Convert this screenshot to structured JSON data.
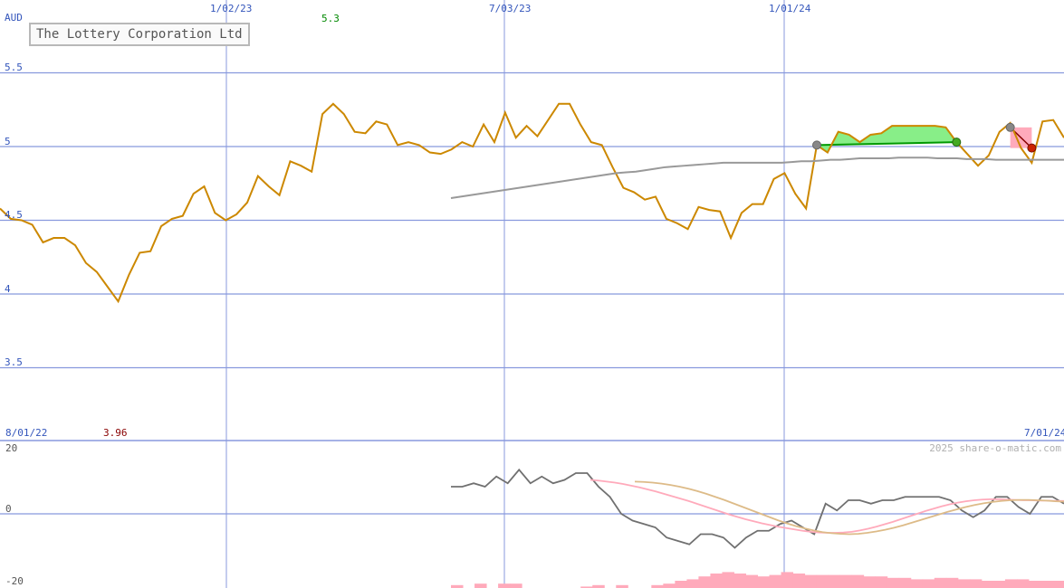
{
  "chart_data": {
    "type": "line",
    "title": "The Lottery Corporation Ltd",
    "currency": "AUD",
    "watermark": "2025 share-o-matic.com",
    "date_range": {
      "start": "8/01/22",
      "end": "7/01/24"
    },
    "high_label": "5.3",
    "low_label": "3.96",
    "x_ticks": [
      "1/02/23",
      "7/03/23",
      "1/01/24"
    ],
    "price_axis": {
      "ticks": [
        "5.5",
        "5",
        "4.5",
        "4",
        "3.5"
      ],
      "ylim": [
        3.5,
        5.5
      ]
    },
    "osc_axis": {
      "ticks": [
        "20",
        "0",
        "-20"
      ],
      "ylim": [
        -20,
        20
      ]
    },
    "colors": {
      "price": "#cc8800",
      "ma_long": "#999999",
      "grid": "#8899dd",
      "axis_text": "#3355bb",
      "high": "#008800",
      "low": "#880000",
      "osc": "#707070",
      "osc_signal1": "#ffaabb",
      "osc_signal2": "#ddbb88",
      "volume": "#ffaabb",
      "gain_fill": "#88ee88",
      "loss_fill": "#ffaabb"
    },
    "series": [
      {
        "name": "price",
        "values": [
          4.58,
          4.51,
          4.5,
          4.47,
          4.35,
          4.38,
          4.38,
          4.33,
          4.21,
          4.15,
          4.05,
          3.95,
          4.13,
          4.28,
          4.29,
          4.46,
          4.51,
          4.53,
          4.68,
          4.73,
          4.55,
          4.5,
          4.54,
          4.62,
          4.8,
          4.73,
          4.67,
          4.9,
          4.87,
          4.83,
          5.22,
          5.29,
          5.22,
          5.1,
          5.09,
          5.17,
          5.15,
          5.01,
          5.03,
          5.01,
          4.96,
          4.95,
          4.98,
          5.03,
          5.0,
          5.15,
          5.03,
          5.23,
          5.06,
          5.14,
          5.07,
          5.18,
          5.29,
          5.29,
          5.15,
          5.03,
          5.01,
          4.86,
          4.72,
          4.69,
          4.64,
          4.66,
          4.51,
          4.48,
          4.44,
          4.59,
          4.57,
          4.56,
          4.38,
          4.55,
          4.61,
          4.61,
          4.78,
          4.82,
          4.68,
          4.58,
          5.01,
          4.96,
          5.1,
          5.08,
          5.03,
          5.08,
          5.09,
          5.14,
          5.14,
          5.14,
          5.14,
          5.14,
          5.13,
          5.03,
          4.95,
          4.87,
          4.94,
          5.1,
          5.16,
          4.99,
          4.89,
          5.17,
          5.18,
          5.06
        ]
      },
      {
        "name": "ma_long",
        "values": [
          4.65,
          4.66,
          4.67,
          4.68,
          4.69,
          4.7,
          4.71,
          4.72,
          4.73,
          4.74,
          4.75,
          4.76,
          4.77,
          4.78,
          4.79,
          4.8,
          4.81,
          4.82,
          4.825,
          4.83,
          4.84,
          4.85,
          4.86,
          4.865,
          4.87,
          4.875,
          4.88,
          4.885,
          4.89,
          4.89,
          4.89,
          4.89,
          4.89,
          4.89,
          4.89,
          4.895,
          4.9,
          4.9,
          4.905,
          4.91,
          4.91,
          4.915,
          4.92,
          4.92,
          4.92,
          4.92,
          4.925,
          4.925,
          4.925,
          4.925,
          4.92,
          4.92,
          4.92,
          4.915,
          4.915,
          4.915,
          4.91,
          4.91,
          4.91,
          4.91,
          4.91,
          4.91,
          4.91,
          4.91
        ]
      },
      {
        "name": "oscillator",
        "values": [
          8,
          8,
          9,
          8,
          11,
          9,
          13,
          9,
          11,
          9,
          10,
          12,
          12,
          8,
          5,
          0,
          -2,
          -3,
          -4,
          -7,
          -8,
          -9,
          -6,
          -6,
          -7,
          -10,
          -7,
          -5,
          -5,
          -3,
          -2,
          -4,
          -6,
          3,
          1,
          4,
          4,
          3,
          4,
          4,
          5,
          5,
          5,
          5,
          4,
          1,
          -1,
          1,
          5,
          5,
          2,
          0,
          5,
          5,
          3
        ]
      },
      {
        "name": "signal_1",
        "values": [
          10,
          9.8,
          9.5,
          9.2,
          8.8,
          8.3,
          7.8,
          7.2,
          6.6,
          5.9,
          5.2,
          4.5,
          3.8,
          3.0,
          2.2,
          1.4,
          0.6,
          -0.2,
          -0.9,
          -1.6,
          -2.2,
          -2.8,
          -3.3,
          -3.8,
          -4.2,
          -4.6,
          -5.0,
          -5.3,
          -5.5,
          -5.6,
          -5.6,
          -5.5,
          -5.3,
          -4.9,
          -4.4,
          -3.8,
          -3.1,
          -2.4,
          -1.6,
          -0.8,
          0,
          0.8,
          1.5,
          2.2,
          2.8,
          3.3,
          3.7,
          4.0,
          4.2,
          4.3,
          4.3,
          4.2,
          4.1,
          4.0,
          4.0,
          3.9,
          3.9,
          3.8,
          3.8
        ]
      },
      {
        "name": "signal_2",
        "values": [
          9.5,
          9.4,
          9.2,
          8.9,
          8.5,
          8.0,
          7.4,
          6.7,
          5.9,
          5.0,
          4.1,
          3.1,
          2.1,
          1.1,
          0.1,
          -0.9,
          -1.9,
          -2.8,
          -3.6,
          -4.3,
          -4.9,
          -5.4,
          -5.7,
          -5.9,
          -6.0,
          -5.9,
          -5.6,
          -5.2,
          -4.7,
          -4.1,
          -3.4,
          -2.6,
          -1.8,
          -1.0,
          -0.2,
          0.6,
          1.3,
          2.0,
          2.6,
          3.1,
          3.5,
          3.8,
          4.0,
          4.1,
          4.1,
          4.0,
          3.9,
          3.7,
          3.6
        ]
      },
      {
        "name": "volume",
        "values": [
          0.2,
          0,
          0.3,
          0,
          0.3,
          0.3,
          0,
          0,
          0,
          0,
          0,
          0.1,
          0.2,
          0,
          0.2,
          0,
          0,
          0.2,
          0.3,
          0.5,
          0.6,
          0.8,
          1.0,
          1.1,
          1.0,
          0.9,
          0.8,
          0.9,
          1.1,
          1.0,
          0.9,
          0.9,
          0.9,
          0.9,
          0.9,
          0.8,
          0.8,
          0.7,
          0.7,
          0.6,
          0.6,
          0.7,
          0.7,
          0.6,
          0.6,
          0.5,
          0.5,
          0.6,
          0.6,
          0.5,
          0.5,
          0.5
        ]
      }
    ],
    "trades": [
      {
        "entry": 5.01,
        "exit": 5.03,
        "result": "gain"
      },
      {
        "entry": 5.13,
        "exit": 4.99,
        "result": "loss"
      }
    ]
  }
}
